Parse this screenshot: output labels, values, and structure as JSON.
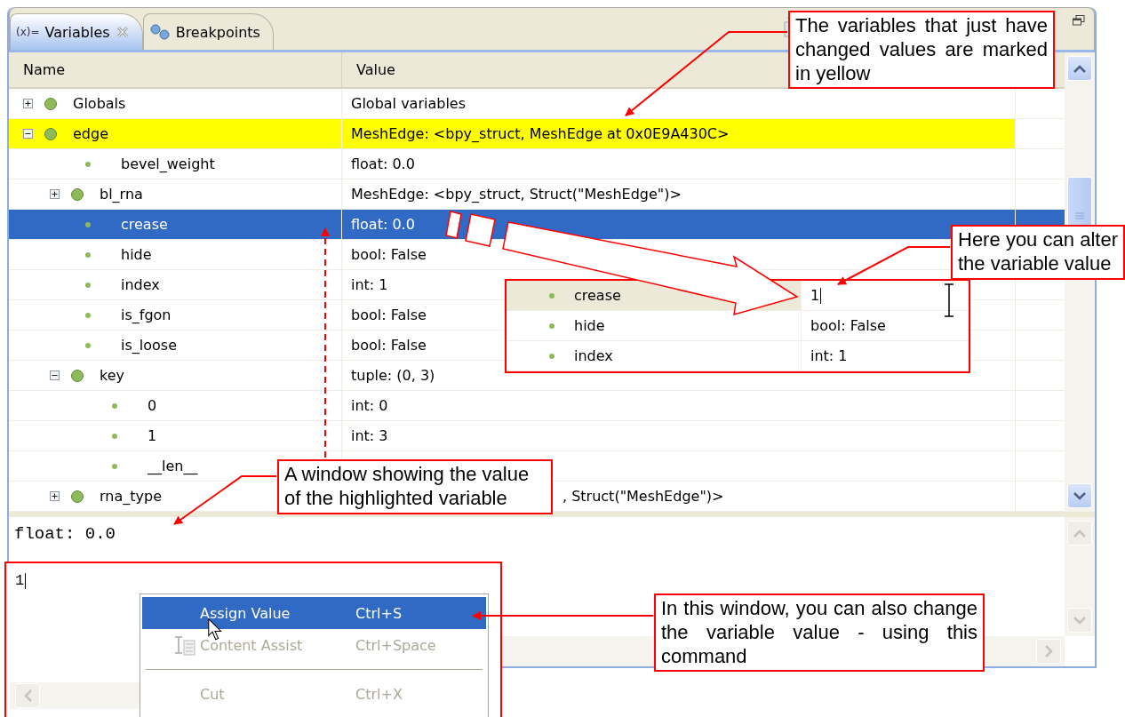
{
  "tabs": [
    {
      "icon_text": "(x)=",
      "label": "Variables",
      "selected": true,
      "closable": true
    },
    {
      "label": "Breakpoints",
      "selected": false,
      "closable": false
    }
  ],
  "columns": [
    "Name",
    "Value"
  ],
  "rows": [
    {
      "kind": "object",
      "name": "Globals",
      "value": "Global variables",
      "expanded": false,
      "changed": false,
      "selected": false
    },
    {
      "kind": "object",
      "name": "edge",
      "value": "MeshEdge: <bpy_struct, MeshEdge at 0x0E9A430C>",
      "expanded": true,
      "changed": true,
      "selected": false,
      "children": [
        {
          "kind": "leaf",
          "name": "bevel_weight",
          "value": "float: 0.0",
          "changed": false,
          "selected": false
        },
        {
          "kind": "object",
          "name": "bl_rna",
          "value": "MeshEdge: <bpy_struct, Struct(\"MeshEdge\")>",
          "expanded": false,
          "changed": false,
          "selected": false
        },
        {
          "kind": "leaf",
          "name": "crease",
          "value": "float: 0.0",
          "changed": false,
          "selected": true
        },
        {
          "kind": "leaf",
          "name": "hide",
          "value": "bool: False",
          "changed": false,
          "selected": false
        },
        {
          "kind": "leaf",
          "name": "index",
          "value": "int: 1",
          "changed": false,
          "selected": false
        },
        {
          "kind": "leaf",
          "name": "is_fgon",
          "value": "bool: False",
          "changed": false,
          "selected": false
        },
        {
          "kind": "leaf",
          "name": "is_loose",
          "value": "bool: False",
          "changed": false,
          "selected": false
        },
        {
          "kind": "object",
          "name": "key",
          "value": "tuple: (0, 3)",
          "expanded": true,
          "changed": false,
          "selected": false,
          "children": [
            {
              "kind": "leaf",
              "name": "0",
              "value": "int: 0",
              "changed": false,
              "selected": false
            },
            {
              "kind": "leaf",
              "name": "1",
              "value": "int: 3",
              "changed": false,
              "selected": false
            },
            {
              "kind": "leaf",
              "name": "__len__",
              "changed": false,
              "selected": false
            }
          ]
        },
        {
          "kind": "object",
          "name": "rna_type",
          "value": ", Struct(\"MeshEdge\")>",
          "covered": true,
          "expanded": false,
          "changed": false,
          "selected": false
        }
      ]
    }
  ],
  "detail": {
    "text": "float: 0.0"
  },
  "zoom_inset": {
    "rows": [
      {
        "name": "crease",
        "value": "1",
        "editing": true
      },
      {
        "name": "hide",
        "value": "bool: False",
        "editing": false
      },
      {
        "name": "index",
        "value": "int: 1",
        "editing": false
      }
    ]
  },
  "editor_inset": {
    "value": "1",
    "menu": [
      {
        "kind": "item",
        "label": "Assign Value",
        "shortcut": "Ctrl+S",
        "selected": true,
        "disabled": false
      },
      {
        "kind": "item",
        "label": "Content Assist",
        "shortcut": "Ctrl+Space",
        "selected": false,
        "disabled": true,
        "icon": true
      },
      {
        "kind": "separator"
      },
      {
        "kind": "item",
        "label": "Cut",
        "shortcut": "Ctrl+X",
        "selected": false,
        "disabled": true
      }
    ]
  },
  "callouts": [
    {
      "text": "The variables that just have changed values are marked in yellow"
    },
    {
      "text": "Here you can alter the variable value"
    },
    {
      "text": "A window showing the value of the highlighted variable"
    },
    {
      "text": "In this window, you can also change the variable value - using this command"
    }
  ]
}
